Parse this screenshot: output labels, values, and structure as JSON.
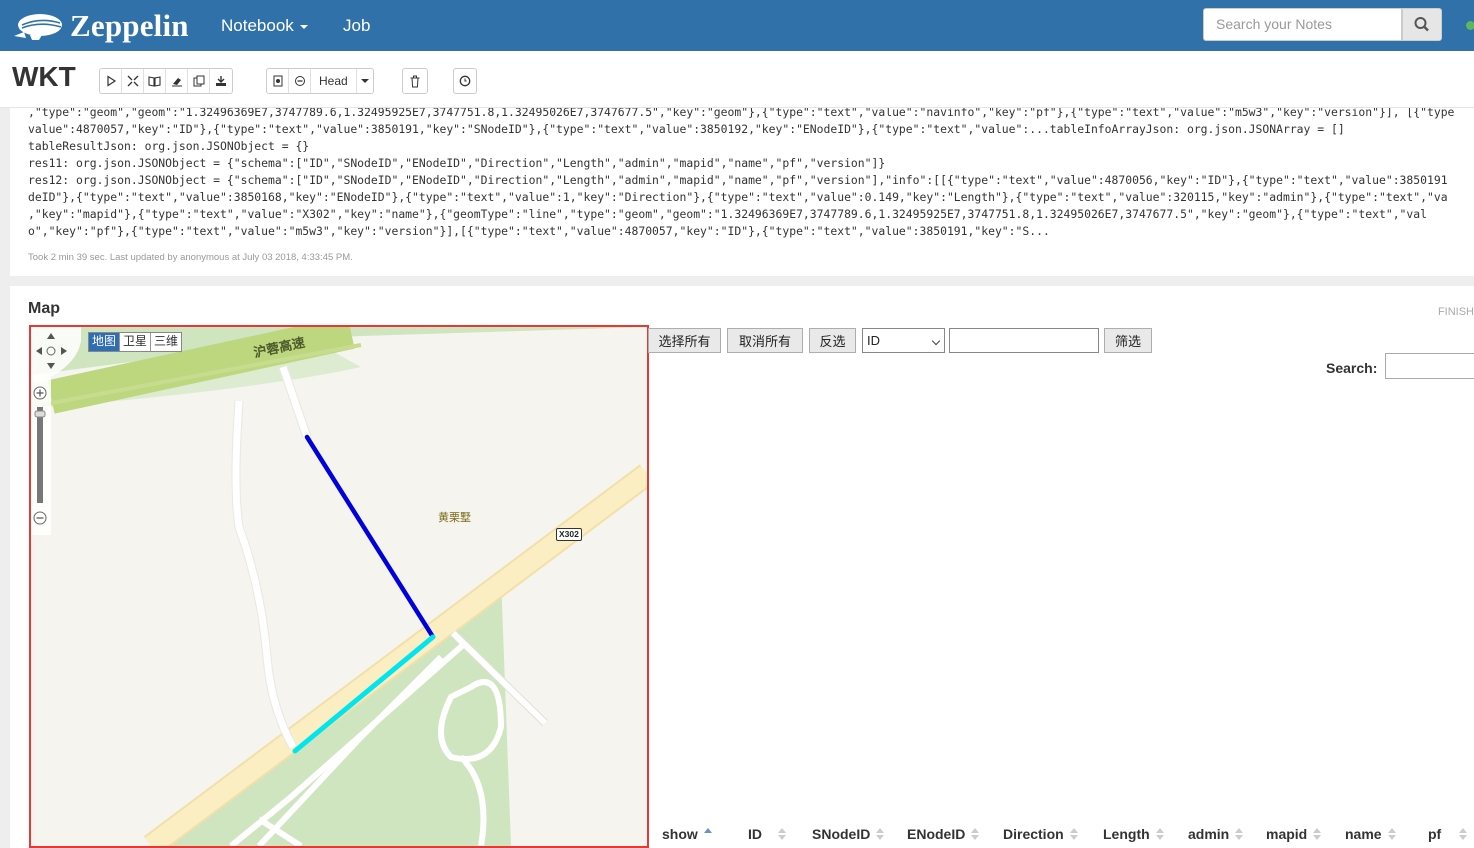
{
  "navbar": {
    "brand": "Zeppelin",
    "notebook_label": "Notebook",
    "job_label": "Job",
    "search_placeholder": "Search your Notes",
    "icons": {
      "logo": "zeppelin-logo-icon",
      "search": "search-icon",
      "status": "connection-status-dot"
    },
    "colors": {
      "bar": "#3071a9",
      "status": "#5cb85c"
    }
  },
  "notebook": {
    "title": "WKT",
    "head_label": "Head",
    "toolbar_icons": [
      "run-all-icon",
      "toggle-code-icon",
      "toggle-output-icon",
      "clear-output-icon",
      "clone-icon",
      "export-icon",
      "version-commit-icon",
      "revision-compare-icon",
      "trash-icon",
      "scheduler-clock-icon"
    ]
  },
  "output": {
    "lines": [
      ",\"type\":\"geom\",\"geom\":\"1.32496369E7,3747789.6,1.32495925E7,3747751.8,1.32495026E7,3747677.5\",\"key\":\"geom\"},{\"type\":\"text\",\"value\":\"navinfo\",\"key\":\"pf\"},{\"type\":\"text\",\"value\":\"m5w3\",\"key\":\"version\"}], [{\"type",
      "value\":4870057,\"key\":\"ID\"},{\"type\":\"text\",\"value\":3850191,\"key\":\"SNodeID\"},{\"type\":\"text\",\"value\":3850192,\"key\":\"ENodeID\"},{\"type\":\"text\",\"value\":...tableInfoArrayJson: org.json.JSONArray = []",
      "tableResultJson: org.json.JSONObject = {}",
      "res11: org.json.JSONObject = {\"schema\":[\"ID\",\"SNodeID\",\"ENodeID\",\"Direction\",\"Length\",\"admin\",\"mapid\",\"name\",\"pf\",\"version\"]}",
      "res12: org.json.JSONObject = {\"schema\":[\"ID\",\"SNodeID\",\"ENodeID\",\"Direction\",\"Length\",\"admin\",\"mapid\",\"name\",\"pf\",\"version\"],\"info\":[[{\"type\":\"text\",\"value\":4870056,\"key\":\"ID\"},{\"type\":\"text\",\"value\":3850191",
      "deID\"},{\"type\":\"text\",\"value\":3850168,\"key\":\"ENodeID\"},{\"type\":\"text\",\"value\":1,\"key\":\"Direction\"},{\"type\":\"text\",\"value\":0.149,\"key\":\"Length\"},{\"type\":\"text\",\"value\":320115,\"key\":\"admin\"},{\"type\":\"text\",\"va",
      ",\"key\":\"mapid\"},{\"type\":\"text\",\"value\":\"X302\",\"key\":\"name\"},{\"geomType\":\"line\",\"type\":\"geom\",\"geom\":\"1.32496369E7,3747789.6,1.32495925E7,3747751.8,1.32495026E7,3747677.5\",\"key\":\"geom\"},{\"type\":\"text\",\"val",
      "o\",\"key\":\"pf\"},{\"type\":\"text\",\"value\":\"m5w3\",\"key\":\"version\"}],[{\"type\":\"text\",\"value\":4870057,\"key\":\"ID\"},{\"type\":\"text\",\"value\":3850191,\"key\":\"S..."
    ],
    "took": "Took 2 min 39 sec. Last updated by anonymous at July 03 2018, 4:33:45 PM."
  },
  "map_paragraph": {
    "title": "Map",
    "status": "FINISH",
    "map": {
      "map_types": [
        "地图",
        "卫星",
        "三维"
      ],
      "active_map_type": "地图",
      "expressway_label": "沪蓉高速",
      "village_label": "黄栗墅",
      "route_badge": "X302",
      "zoom_in": "+",
      "zoom_out": "−",
      "colors": {
        "selected_link": "#0000dd",
        "highlight_link": "#00e5ee",
        "frame": "#e53935",
        "green": "#cfe5bf",
        "road_yellow": "#fbeec3"
      }
    },
    "controls": {
      "select_all": "选择所有",
      "deselect_all": "取消所有",
      "invert": "反选",
      "field_select": "ID",
      "filter_value": "",
      "filter": "筛选"
    },
    "search_label": "Search:",
    "search_value": "",
    "columns": [
      "show",
      "ID",
      "SNodeID",
      "ENodeID",
      "Direction",
      "Length",
      "admin",
      "mapid",
      "name",
      "pf"
    ],
    "sorted_column": "show",
    "sort_direction": "asc"
  }
}
